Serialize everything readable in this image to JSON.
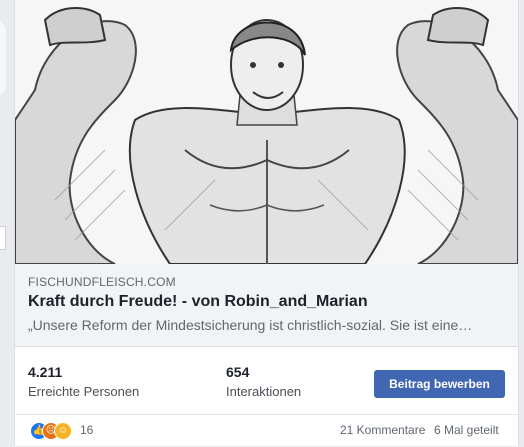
{
  "link_preview": {
    "domain": "FISCHUNDFLEISCH.COM",
    "title": "Kraft durch Freude! - von Robin_and_Marian",
    "description": "„Unsere Reform der Mindestsicherung ist christlich-sozial. Sie ist eine…"
  },
  "insights": {
    "reach_value": "4.211",
    "reach_label": "Erreichte Personen",
    "engagement_value": "654",
    "engagement_label": "Interaktionen",
    "boost_button_label": "Beitrag bewerben"
  },
  "footer": {
    "reaction_icons": [
      "like-icon",
      "angry-icon",
      "haha-icon"
    ],
    "reaction_count": "16",
    "comments": "21 Kommentare",
    "shares": "6 Mal geteilt"
  },
  "colors": {
    "boost_button": "#4267b2",
    "like": "#1877f2",
    "angry": "#e9710f",
    "haha": "#f7b125"
  }
}
